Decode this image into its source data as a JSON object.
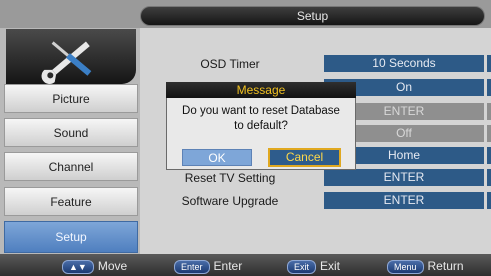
{
  "header": {
    "title": "Setup"
  },
  "sidebar": {
    "icon": "tools-icon",
    "items": [
      {
        "label": "Picture"
      },
      {
        "label": "Sound"
      },
      {
        "label": "Channel"
      },
      {
        "label": "Feature"
      },
      {
        "label": "Setup",
        "active": true
      }
    ]
  },
  "settings": [
    {
      "label": "OSD Timer",
      "value": "10 Seconds"
    },
    {
      "label": "",
      "value": "On"
    },
    {
      "label": "",
      "value": "ENTER"
    },
    {
      "label": "",
      "value": "Off"
    },
    {
      "label": "",
      "value": "Home"
    },
    {
      "label": "Reset TV Setting",
      "value": "ENTER"
    },
    {
      "label": "Software Upgrade",
      "value": "ENTER"
    }
  ],
  "dialog": {
    "title": "Message",
    "text_line1": "Do you want to reset Database",
    "text_line2": "to default?",
    "ok_label": "OK",
    "cancel_label": "Cancel"
  },
  "footer": {
    "move_key": "▲▼",
    "move_label": "Move",
    "enter_key": "Enter",
    "enter_label": "Enter",
    "exit_key": "Exit",
    "exit_label": "Exit",
    "menu_key": "Menu",
    "menu_label": "Return"
  },
  "colors": {
    "accent": "#2d5a87",
    "highlight": "#f0c020",
    "active_tab": "#6c97cf"
  }
}
